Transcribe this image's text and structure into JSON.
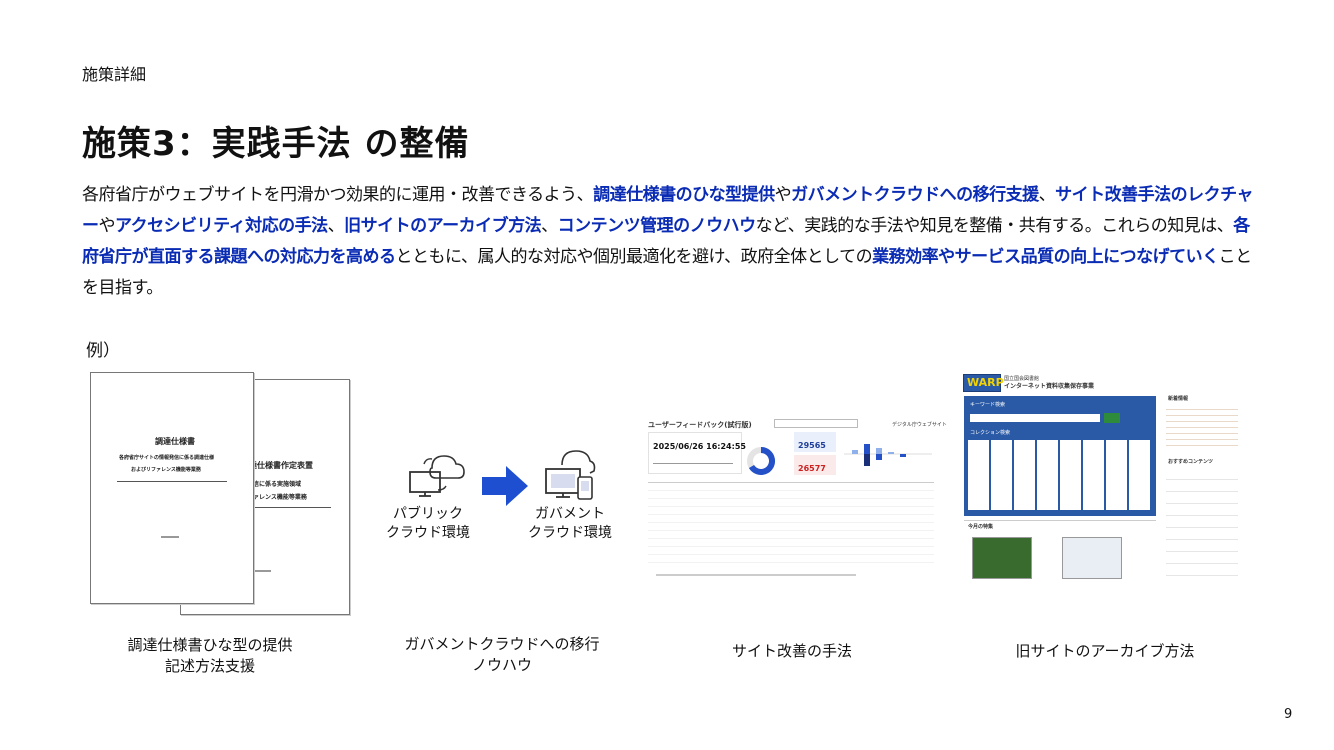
{
  "header": {
    "eyebrow": "施策詳細",
    "title": "施策3：実践手法 の整備"
  },
  "body": [
    {
      "t": "各府省庁がウェブサイトを円滑かつ効果的に運用・改善できるよう、",
      "h": false
    },
    {
      "t": "調達仕様書のひな型提供",
      "h": true
    },
    {
      "t": "や",
      "h": false
    },
    {
      "t": "ガバメントクラウドへの移行支援",
      "h": true
    },
    {
      "t": "、",
      "h": false
    },
    {
      "t": "サイト改善手法のレクチャー",
      "h": true
    },
    {
      "t": "や",
      "h": false
    },
    {
      "t": "アクセシビリティ対応の手法",
      "h": true
    },
    {
      "t": "、",
      "h": false
    },
    {
      "t": "旧サイトのアーカイブ方法",
      "h": true
    },
    {
      "t": "、",
      "h": false
    },
    {
      "t": "コンテンツ管理のノウハウ",
      "h": true
    },
    {
      "t": "など、実践的な手法や知見を整備・共有する。これらの知見は、",
      "h": false
    },
    {
      "t": "各府省庁が直面する課題への対応力を高める",
      "h": true
    },
    {
      "t": "とともに、属人的な対応や個別最適化を避け、政府全体としての",
      "h": false
    },
    {
      "t": "業務効率やサービス品質の向上につなげていく",
      "h": true
    },
    {
      "t": "ことを目指す。",
      "h": false
    }
  ],
  "example_label": "例）",
  "examples": {
    "doc": {
      "title": "調達仕様書",
      "subtitle": "各府省庁サイトの情報発信に係る調達仕様",
      "subtitle2": "およびリファレンス機能等業務",
      "back_title": "調達仕様書作定表置",
      "back_sub": "サイトの情報発信に係る実施領域",
      "back_sub2": "リファレンス機能等業務",
      "caption_line1": "調達仕様書ひな型の提供",
      "caption_line2": "記述方法支援"
    },
    "cloud": {
      "public_line1": "パブリック",
      "public_line2": "クラウド環境",
      "gov_line1": "ガバメント",
      "gov_line2": "クラウド環境",
      "caption_line1": "ガバメントクラウドへの移行",
      "caption_line2": "ノウハウ"
    },
    "feedback": {
      "title": "ユーザーフィードバック(試行版)",
      "site": "デジタル庁ウェブサイト",
      "date": "2025/06/26 16:24:55",
      "metric1": "29565",
      "metric2": "26577",
      "caption": "サイト改善の手法"
    },
    "warp": {
      "logo": "WARP",
      "org": "国立国会図書館",
      "name": "インターネット資料収集保存事業",
      "search_label": "キーワード検索",
      "collection_label": "コレクション検索",
      "news_label": "新着情報",
      "recommend_label": "おすすめコンテンツ",
      "featured_label": "今月の特集",
      "caption": "旧サイトのアーカイブ方法"
    }
  },
  "page_number": "9",
  "colors": {
    "highlight": "#0a2bb4",
    "arrow": "#1f4fd1",
    "warp_blue": "#2a5aa6"
  }
}
